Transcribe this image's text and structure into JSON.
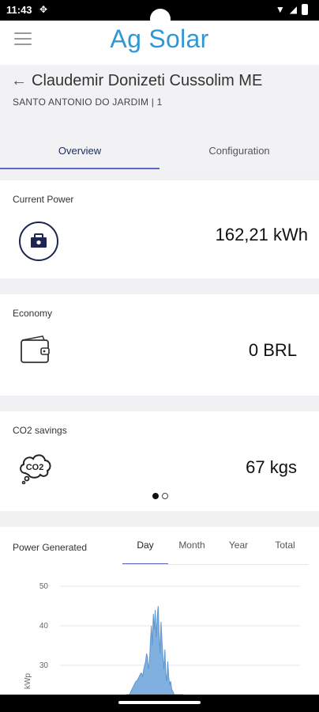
{
  "status_bar": {
    "time": "11:43",
    "sync_icon": "sync-icon",
    "wifi_icon": "wifi-icon",
    "signal_icon": "signal-icon",
    "battery_icon": "battery-icon"
  },
  "app_bar": {
    "title": "Ag Solar",
    "menu_icon": "hamburger-menu-icon"
  },
  "header": {
    "plant_name": "Claudemir Donizeti Cussolim ME",
    "subtitle": "SANTO ANTONIO DO JARDIM | 1",
    "back_icon": "back-arrow-icon"
  },
  "tabs": [
    {
      "label": "Overview",
      "active": true
    },
    {
      "label": "Configuration",
      "active": false
    }
  ],
  "cards": {
    "current_power": {
      "label": "Current Power",
      "value": "162,21 kWh",
      "icon": "solar-panel-icon"
    },
    "economy": {
      "label": "Economy",
      "value": "0 BRL",
      "icon": "wallet-icon"
    },
    "co2": {
      "label": "CO2 savings",
      "value": "67 kgs",
      "icon": "co2-cloud-icon",
      "icon_text": "CO2"
    }
  },
  "pager": {
    "count": 2,
    "active_index": 0
  },
  "power_generated": {
    "label": "Power Generated",
    "periods": [
      "Day",
      "Month",
      "Year",
      "Total"
    ],
    "active_period": "Day"
  },
  "chart_data": {
    "type": "area",
    "title": "",
    "xlabel": "",
    "ylabel": "kWp",
    "ylim": [
      20,
      50
    ],
    "yticks": [
      50,
      40,
      30
    ],
    "color": "#7fb0e0",
    "x": [
      0,
      1,
      2,
      3,
      4,
      5,
      6,
      7,
      8,
      9,
      10,
      11,
      12,
      13,
      14,
      15,
      16,
      17,
      18,
      19,
      20,
      21,
      22,
      23,
      24,
      25,
      26,
      27,
      28,
      29,
      30,
      31,
      32,
      33,
      34,
      35,
      36,
      37,
      38,
      39,
      40,
      41,
      42,
      43,
      44,
      45,
      46,
      47,
      48,
      49,
      50,
      51,
      52,
      53,
      54,
      55,
      56,
      57,
      58,
      59
    ],
    "series": [
      {
        "values": [
          20,
          21,
          22,
          22.5,
          23,
          23.5,
          24,
          24.5,
          25,
          25.5,
          26,
          26,
          26.5,
          27,
          27.5,
          28,
          28,
          27,
          29,
          30,
          31,
          33,
          32,
          29,
          31,
          36,
          40,
          35,
          43,
          39,
          44,
          37,
          42,
          45,
          38,
          33,
          41,
          36,
          32,
          29,
          34,
          28,
          26,
          31,
          27,
          25,
          26,
          24,
          23.5,
          23,
          22.5,
          22,
          22.5,
          22,
          21.5,
          21,
          20.5,
          20.5,
          20,
          20
        ]
      }
    ]
  }
}
